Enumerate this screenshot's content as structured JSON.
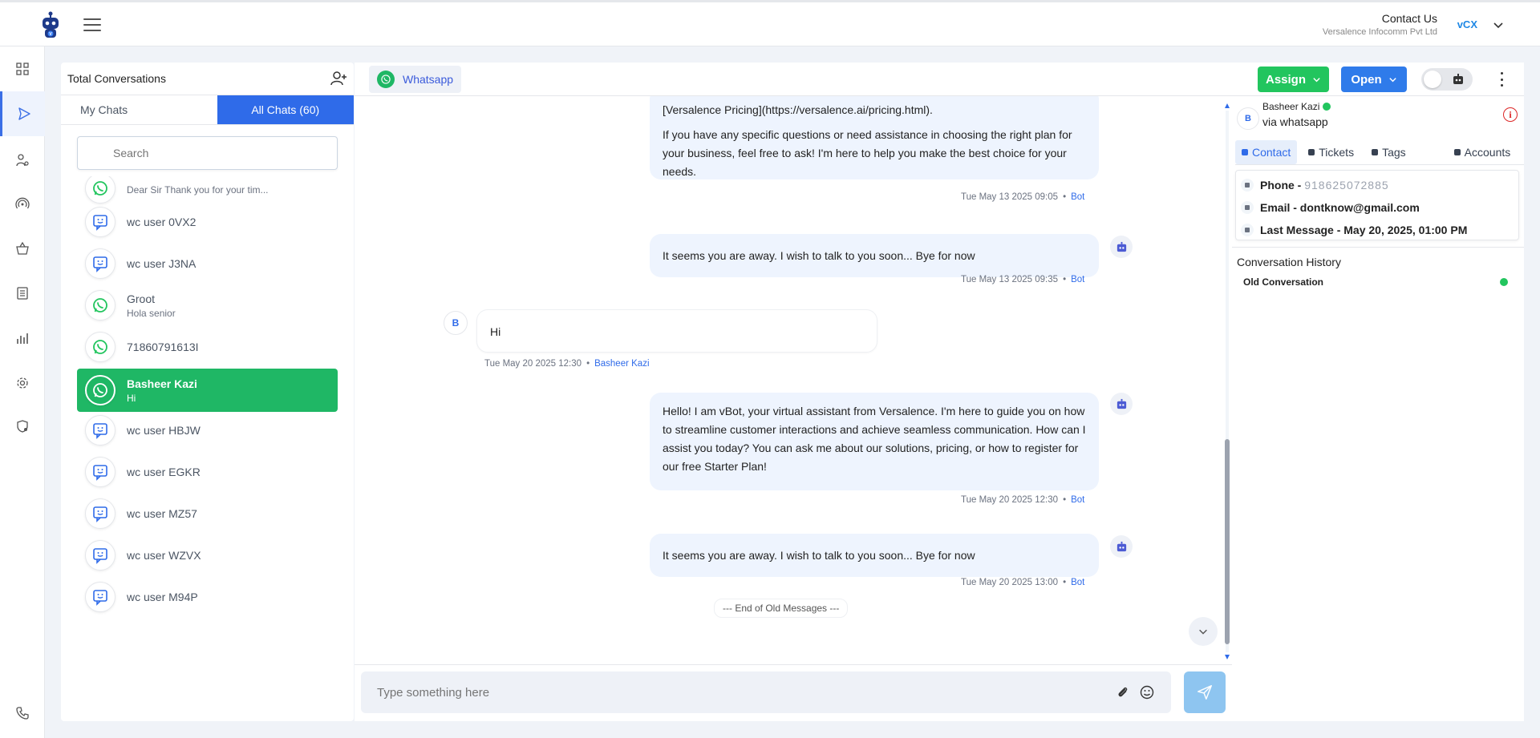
{
  "header": {
    "contact_us": "Contact Us",
    "company": "Versalence Infocomm Pvt Ltd",
    "brand": "vCX"
  },
  "colors": {
    "primary": "#2f6be9",
    "whatsapp_green": "#1fb765",
    "assign_green": "#22c55e",
    "open_blue": "#2f7bea"
  },
  "rail": {
    "icons": [
      "dashboard-icon",
      "send-icon",
      "agent-icon",
      "broadcast-icon",
      "basket-icon",
      "document-icon",
      "chart-icon",
      "settings-icon",
      "shield-icon",
      "phone-icon"
    ]
  },
  "list": {
    "title": "Total Conversations",
    "tabs": [
      {
        "label": "My Chats"
      },
      {
        "label": "All Chats (60)"
      }
    ],
    "search_placeholder": "Search",
    "items": [
      {
        "name": "",
        "preview": "Dear Sir Thank you for your tim...",
        "icon": "whatsapp-icon"
      },
      {
        "name": "wc user 0VX2",
        "preview": "",
        "icon": "webchat-icon"
      },
      {
        "name": "wc user J3NA",
        "preview": "",
        "icon": "webchat-icon"
      },
      {
        "name": "Groot",
        "preview": "Hola senior",
        "icon": "whatsapp-icon"
      },
      {
        "name": "71860791613I",
        "preview": "",
        "icon": "whatsapp-icon"
      },
      {
        "name": "Basheer Kazi",
        "preview": "Hi",
        "icon": "whatsapp-icon"
      },
      {
        "name": "wc user HBJW",
        "preview": "",
        "icon": "webchat-icon"
      },
      {
        "name": "wc user EGKR",
        "preview": "",
        "icon": "webchat-icon"
      },
      {
        "name": "wc user MZ57",
        "preview": "",
        "icon": "webchat-icon"
      },
      {
        "name": "wc user WZVX",
        "preview": "",
        "icon": "webchat-icon"
      },
      {
        "name": "wc user M94P",
        "preview": "",
        "icon": "webchat-icon"
      }
    ]
  },
  "chat": {
    "channel": "Whatsapp",
    "messages": [
      {
        "text_lines": [
          "[Versalence Pricing](https://versalence.ai/pricing.html).",
          "If you have any specific questions or need assistance in choosing the right plan for your business, feel free to ask! I'm here to help you make the best choice for your needs."
        ],
        "time": "Tue May 13 2025 09:05",
        "sender": "Bot"
      },
      {
        "text": "It seems you are away. I wish to talk to you soon... Bye for now",
        "time": "Tue May 13 2025 09:35",
        "sender": "Bot"
      },
      {
        "text": "Hi",
        "time": "Tue May 20 2025 12:30",
        "sender": "Basheer Kazi",
        "avatar": "B"
      },
      {
        "text": "Hello! I am vBot, your virtual assistant from Versalence. I'm here to guide you on how to streamline customer interactions and achieve seamless communication. How can I assist you today? You can ask me about our solutions, pricing, or how to register for our free Starter Plan!",
        "time": "Tue May 20 2025 12:30",
        "sender": "Bot"
      },
      {
        "text": "It seems you are away. I wish to talk to you soon... Bye for now",
        "time": "Tue May 20 2025 13:00",
        "sender": "Bot"
      }
    ],
    "end_marker": "--- End of Old Messages ---",
    "composer_placeholder": "Type something here"
  },
  "right": {
    "assign_label": "Assign",
    "open_label": "Open",
    "customer": {
      "avatar": "B",
      "name": "Basheer Kazi",
      "via": "via whatsapp"
    },
    "tabs": [
      {
        "label": "Contact"
      },
      {
        "label": "Tickets"
      },
      {
        "label": "Tags"
      },
      {
        "label": "Accounts"
      }
    ],
    "contact": {
      "phone_label": "Phone - ",
      "phone_value": "918625072885",
      "email": "Email - dontknow@gmail.com",
      "last_message": "Last Message - May 20, 2025, 01:00 PM"
    },
    "history_title": "Conversation History",
    "history_item": "Old Conversation"
  }
}
